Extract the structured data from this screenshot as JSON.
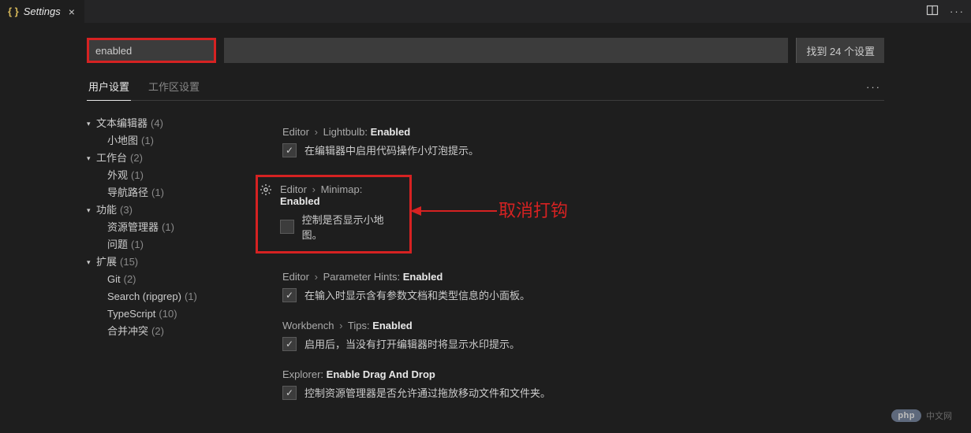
{
  "titlebar": {
    "icon_text": "{ }",
    "title": "Settings",
    "close_glyph": "×"
  },
  "search": {
    "value": "enabled",
    "result_text": "找到 24 个设置"
  },
  "tabs": {
    "user": "用户设置",
    "workspace": "工作区设置",
    "more": "···"
  },
  "tree": [
    {
      "label": "文本编辑器",
      "count": "(4)",
      "children": [
        {
          "label": "小地图",
          "count": "(1)"
        }
      ]
    },
    {
      "label": "工作台",
      "count": "(2)",
      "children": [
        {
          "label": "外观",
          "count": "(1)"
        },
        {
          "label": "导航路径",
          "count": "(1)"
        }
      ]
    },
    {
      "label": "功能",
      "count": "(3)",
      "children": [
        {
          "label": "资源管理器",
          "count": "(1)"
        },
        {
          "label": "问题",
          "count": "(1)"
        }
      ]
    },
    {
      "label": "扩展",
      "count": "(15)",
      "children": [
        {
          "label": "Git",
          "count": "(2)"
        },
        {
          "label": "Search (ripgrep)",
          "count": "(1)"
        },
        {
          "label": "TypeScript",
          "count": "(10)"
        },
        {
          "label": "合并冲突",
          "count": "(2)"
        }
      ]
    }
  ],
  "settings": {
    "lightbulb": {
      "crumb1": "Editor",
      "crumb2": "Lightbulb",
      "key": "Enabled",
      "checked": "✓",
      "desc": "在编辑器中启用代码操作小灯泡提示。"
    },
    "minimap": {
      "crumb1": "Editor",
      "crumb2": "Minimap",
      "key": "Enabled",
      "checked": "",
      "desc": "控制是否显示小地图。"
    },
    "paramhints": {
      "crumb1": "Editor",
      "crumb2": "Parameter Hints",
      "key": "Enabled",
      "checked": "✓",
      "desc": "在输入时显示含有参数文档和类型信息的小面板。"
    },
    "tips": {
      "crumb1": "Workbench",
      "crumb2": "Tips",
      "key": "Enabled",
      "checked": "✓",
      "desc": "启用后，当没有打开编辑器时将显示水印提示。"
    },
    "dragdrop": {
      "crumb1": "Explorer",
      "key": "Enable Drag And Drop",
      "checked": "✓",
      "desc": "控制资源管理器是否允许通过拖放移动文件和文件夹。"
    }
  },
  "annotation": "取消打钩",
  "watermark": {
    "badge": "php",
    "text": "中文网"
  }
}
